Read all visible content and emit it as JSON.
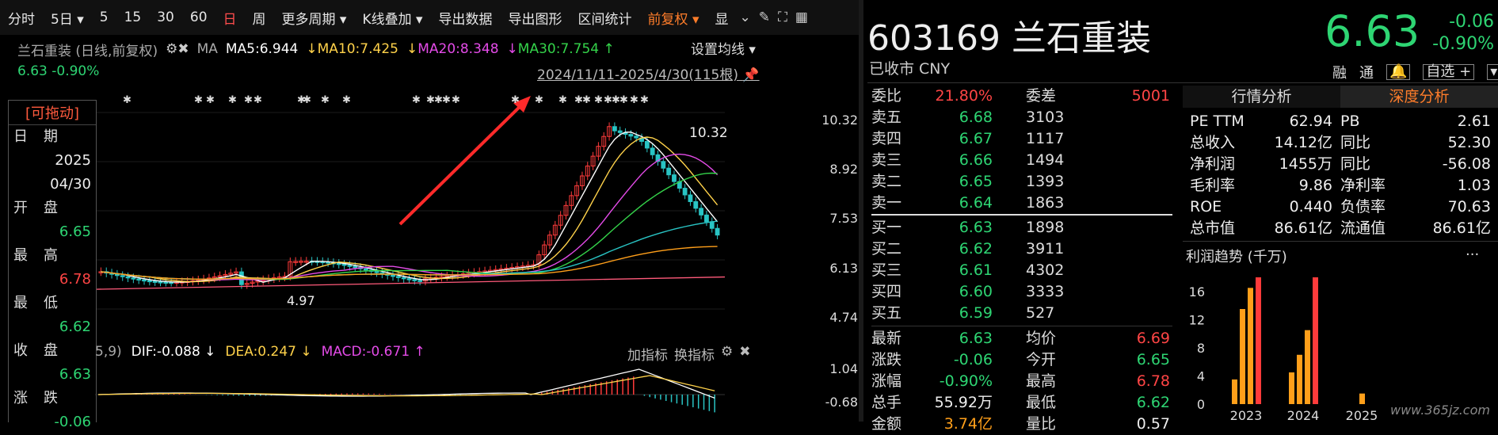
{
  "toolbar": {
    "items": [
      "分时",
      "5日",
      "5",
      "15",
      "30",
      "60",
      "日",
      "周",
      "更多周期",
      "K线叠加",
      "导出数据",
      "导出图形",
      "区间统计",
      "前复权",
      "显"
    ],
    "active": "日",
    "accent": "前复权"
  },
  "chart": {
    "title": "兰石重装 (日线,前复权)",
    "ma_label": "MA",
    "ma5": "MA5:6.944",
    "ma10": "MA10:7.425",
    "ma20": "MA20:8.348",
    "ma30": "MA30:7.754",
    "set_ma": "设置均线",
    "change_line": "6.63 -0.90%",
    "date_range": "2024/11/11-2025/4/30(115根)",
    "high_label": "10.32",
    "low_label": "4.97",
    "y_ticks": [
      "10.32",
      "8.92",
      "7.53",
      "6.13",
      "4.74"
    ],
    "macd": {
      "prefix": "5,9)",
      "dif": "DIF:-0.088",
      "dea": "DEA:0.247",
      "macd": "MACD:-0.671",
      "add": "加指标",
      "swap": "换指标",
      "y_ticks": [
        "1.04",
        "-0.68"
      ]
    }
  },
  "info_panel": {
    "drag": "[可拖动]",
    "rows": [
      {
        "label": "日期",
        "value": ""
      },
      {
        "label": "",
        "value": "2025"
      },
      {
        "label": "",
        "value": "04/30"
      },
      {
        "label": "开盘",
        "value": ""
      },
      {
        "label": "",
        "value": "6.65"
      },
      {
        "label": "最高",
        "value": ""
      },
      {
        "label": "",
        "value": "6.78"
      },
      {
        "label": "最低",
        "value": ""
      },
      {
        "label": "",
        "value": "6.62"
      },
      {
        "label": "收盘",
        "value": ""
      },
      {
        "label": "",
        "value": "6.63"
      },
      {
        "label": "涨跌",
        "value": ""
      },
      {
        "label": "",
        "value": "-0.06"
      }
    ]
  },
  "quote": {
    "code_name": "603169 兰石重装",
    "price": "6.63",
    "change": "-0.06",
    "change_pct": "-0.90%",
    "status": "已收市 CNY",
    "ops": [
      "融",
      "通",
      "自选 +"
    ],
    "weibi_label": "委比",
    "weibi": "21.80%",
    "weicha_label": "委差",
    "weicha": "5001",
    "sells": [
      {
        "label": "卖五",
        "price": "6.68",
        "vol": "3103"
      },
      {
        "label": "卖四",
        "price": "6.67",
        "vol": "1117"
      },
      {
        "label": "卖三",
        "price": "6.66",
        "vol": "1494"
      },
      {
        "label": "卖二",
        "price": "6.65",
        "vol": "1393"
      },
      {
        "label": "卖一",
        "price": "6.64",
        "vol": "1863"
      }
    ],
    "buys": [
      {
        "label": "买一",
        "price": "6.63",
        "vol": "1898"
      },
      {
        "label": "买二",
        "price": "6.62",
        "vol": "3911"
      },
      {
        "label": "买三",
        "price": "6.61",
        "vol": "4302"
      },
      {
        "label": "买四",
        "price": "6.60",
        "vol": "3333"
      },
      {
        "label": "买五",
        "price": "6.59",
        "vol": "527"
      }
    ],
    "stats": [
      {
        "k1": "最新",
        "v1": "6.63",
        "c1": "green",
        "k2": "均价",
        "v2": "6.69",
        "c2": "red"
      },
      {
        "k1": "涨跌",
        "v1": "-0.06",
        "c1": "green",
        "k2": "今开",
        "v2": "6.65",
        "c2": "green"
      },
      {
        "k1": "涨幅",
        "v1": "-0.90%",
        "c1": "green",
        "k2": "最高",
        "v2": "6.78",
        "c2": "red"
      },
      {
        "k1": "总手",
        "v1": "55.92万",
        "c1": "white",
        "k2": "最低",
        "v2": "6.62",
        "c2": "green"
      },
      {
        "k1": "金额",
        "v1": "3.74亿",
        "c1": "orange",
        "k2": "量比",
        "v2": "0.57",
        "c2": "white"
      }
    ]
  },
  "analysis": {
    "tabs": [
      "行情分析",
      "深度分析"
    ],
    "rows": [
      {
        "k1": "PE TTM",
        "v1": "62.94",
        "k2": "PB",
        "v2": "2.61"
      },
      {
        "k1": "总收入",
        "v1": "14.12亿",
        "k2": "同比",
        "v2": "52.30"
      },
      {
        "k1": "净利润",
        "v1": "1455万",
        "k2": "同比",
        "v2": "-56.08"
      },
      {
        "k1": "毛利率",
        "v1": "9.86",
        "k2": "净利率",
        "v2": "1.03"
      },
      {
        "k1": "ROE",
        "v1": "0.440",
        "k2": "负债率",
        "v2": "70.63"
      },
      {
        "k1": "总市值",
        "v1": "86.61亿",
        "k2": "流通值",
        "v2": "86.61亿"
      }
    ],
    "profit_title": "利润趋势 (千万)",
    "profit_more": "..."
  },
  "chart_data": {
    "type": "bar",
    "title": "利润趋势 (千万)",
    "x": [
      "2023",
      "2024",
      "2025"
    ],
    "yticks": [
      16,
      12,
      8,
      4,
      0
    ],
    "ylim": [
      0,
      18
    ],
    "series": [
      {
        "values": [
          3.5,
          13.5,
          16.5,
          18.0
        ],
        "year": "2023",
        "colors": [
          "#ff9f1a",
          "#ff9f1a",
          "#ff9f1a",
          "#ff3b3b"
        ]
      },
      {
        "values": [
          4.5,
          7.0,
          10.5,
          18.0
        ],
        "year": "2024",
        "colors": [
          "#ff9f1a",
          "#ff9f1a",
          "#ff9f1a",
          "#ff3b3b"
        ]
      },
      {
        "values": [
          1.5
        ],
        "year": "2025",
        "colors": [
          "#ff9f1a"
        ]
      }
    ]
  },
  "watermark": "www.365jz.com"
}
